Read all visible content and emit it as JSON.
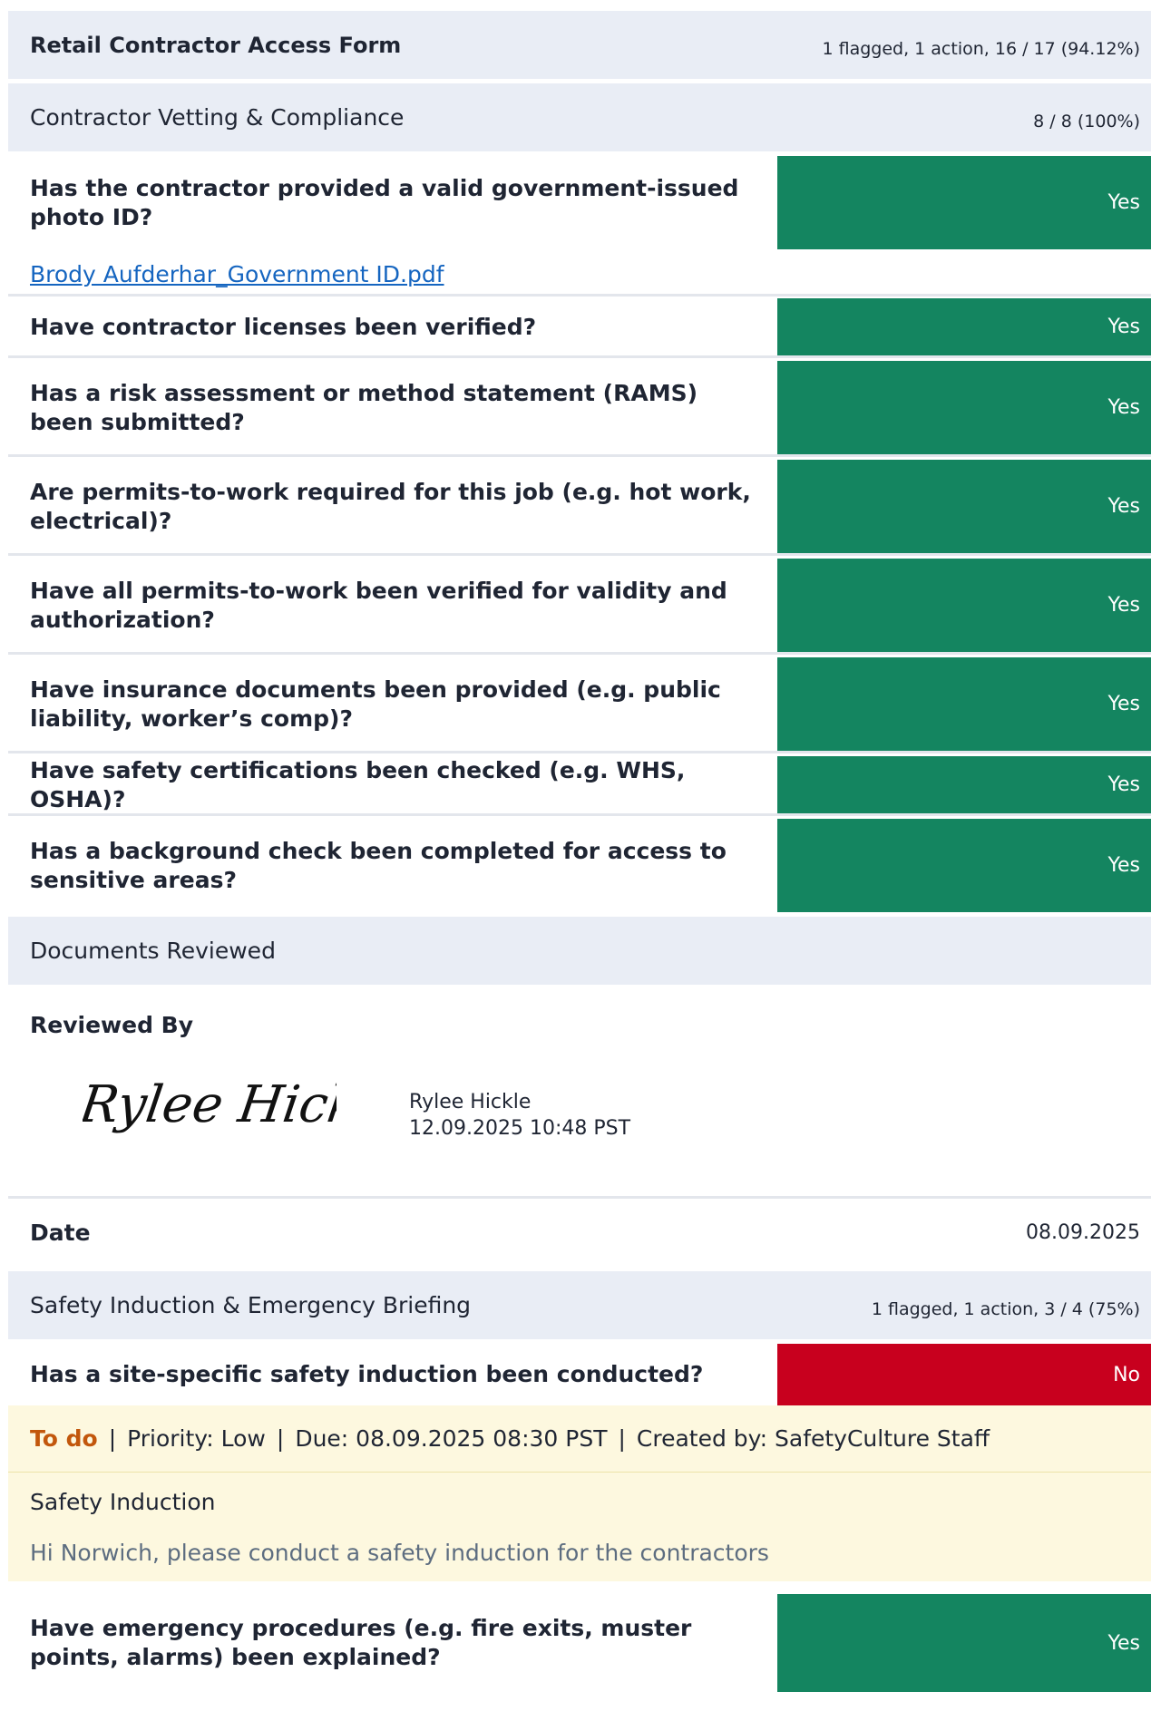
{
  "form": {
    "title": "Retail Contractor Access Form",
    "summary": "1 flagged, 1 action, 16 / 17 (94.12%)"
  },
  "sections": {
    "vetting": {
      "title": "Contractor Vetting & Compliance",
      "score": "8 / 8 (100%)",
      "questions": [
        {
          "text": "Has the contractor provided a valid government-issued photo ID?",
          "answer": "Yes",
          "attachment": "Brody Aufderhar_Government ID.pdf"
        },
        {
          "text": "Have contractor licenses been verified?",
          "answer": "Yes"
        },
        {
          "text": "Has a risk assessment or method statement (RAMS) been submitted?",
          "answer": "Yes"
        },
        {
          "text": "Are permits-to-work required for this job (e.g. hot work, electrical)?",
          "answer": "Yes"
        },
        {
          "text": "Have all permits-to-work been verified for validity and authorization?",
          "answer": "Yes"
        },
        {
          "text": "Have insurance documents been provided (e.g. public liability, worker’s comp)?",
          "answer": "Yes"
        },
        {
          "text": "Have safety certifications been checked (e.g. WHS, OSHA)?",
          "answer": "Yes"
        },
        {
          "text": "Has a background check been completed for access to sensitive areas?",
          "answer": "Yes"
        }
      ]
    },
    "documents": {
      "title": "Documents Reviewed",
      "reviewed_by_label": "Reviewed By",
      "signature_name": "Rylee Hickle",
      "signer_name": "Rylee Hickle",
      "signed_at": "12.09.2025 10:48 PST",
      "date_label": "Date",
      "date_value": "08.09.2025"
    },
    "induction": {
      "title": "Safety Induction & Emergency Briefing",
      "score": "1 flagged, 1 action, 3 / 4 (75%)",
      "questions": [
        {
          "text": "Has a site-specific safety induction been conducted?",
          "answer": "No"
        },
        {
          "text": "Have emergency procedures (e.g. fire exits, muster points, alarms) been explained?",
          "answer": "Yes"
        }
      ],
      "action": {
        "status": "To do",
        "separator": "|",
        "priority": "Priority: Low",
        "due": "Due: 08.09.2025 08:30 PST",
        "created_by": "Created by: SafetyCulture Staff",
        "title": "Safety Induction",
        "description": "Hi Norwich, please conduct a safety induction for the contractors"
      }
    }
  },
  "colors": {
    "yes": "#148560",
    "no": "#c8001e",
    "header_bg": "#e9edf5",
    "action_bg": "#fdf8df",
    "todo": "#c2570c",
    "link": "#1565c0"
  }
}
